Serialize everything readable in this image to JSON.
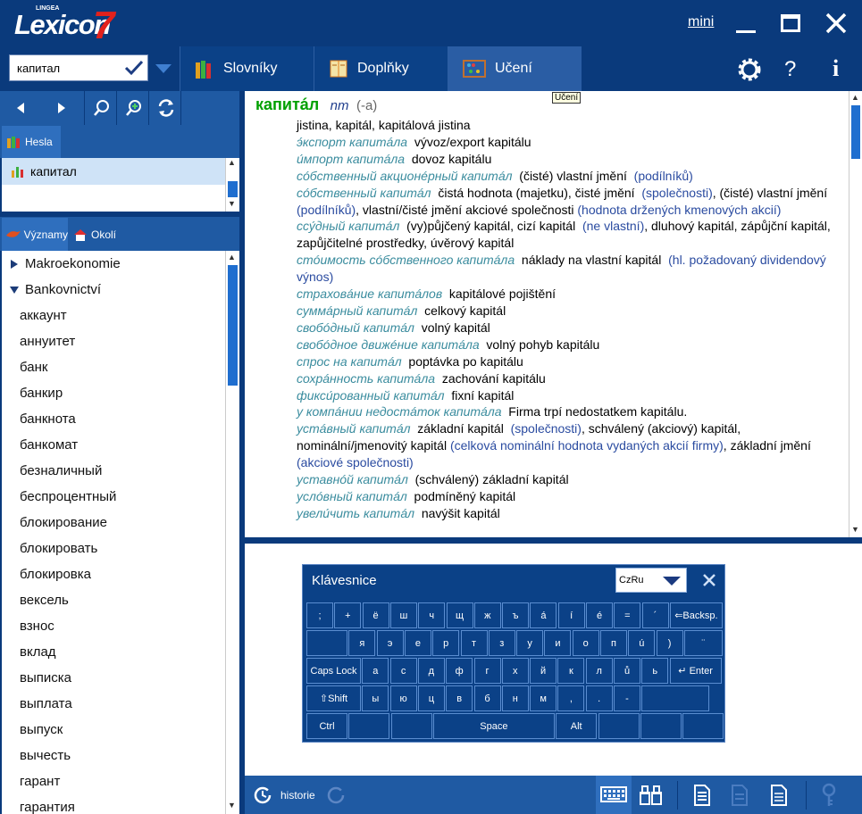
{
  "app": {
    "logo_small": "LINGEA",
    "logo_text": "Lexicon",
    "logo_version": "7",
    "mini_label": "mini"
  },
  "search": {
    "value": "капитал"
  },
  "tabs": [
    {
      "label": "Slovníky"
    },
    {
      "label": "Doplňky"
    },
    {
      "label": "Učení"
    }
  ],
  "tooltip": "Učení",
  "left": {
    "hesla_label": "Hesla",
    "hesla_items": [
      "капитал"
    ],
    "vyznamy_label": "Významy",
    "okoli_label": "Okolí",
    "tree_groups": [
      "Makroekonomie",
      "Bankovnictví"
    ],
    "tree_items": [
      "аккаунт",
      "аннуитет",
      "банк",
      "банкир",
      "банкнота",
      "банкомат",
      "безналичный",
      "беспроцентный",
      "блокирование",
      "блокировать",
      "блокировка",
      "вексель",
      "взнос",
      "вклад",
      "выписка",
      "выплата",
      "выпуск",
      "вычесть",
      "гарант",
      "гарантия"
    ]
  },
  "entry": {
    "headword": "капитáл",
    "pos": "nm",
    "gen": "(-a)",
    "first": "jistina, kapitál, kapitálová jistina",
    "lines": [
      {
        "ru": "э́кспорт капитáла",
        "cz": "vývoz/export kapitálu"
      },
      {
        "ru": "и́мпорт капитáла",
        "cz": "dovoz kapitálu"
      },
      {
        "ru": "сóбственный акционéрный капитáл",
        "cz": "(čisté) vlastní jmění",
        "cm": "(podílníků)"
      },
      {
        "ru": "сóбственный капитáл",
        "cz": "čistá hodnota (majetku), čisté jmění",
        "cm": "(společnosti)",
        "cz2": ", (čisté) vlastní jmění",
        "cm2": "(podílníků)",
        "cz3": ", vlastní/čisté jmění akciové společnosti",
        "cm3": "(hodnota držených kmenových akcií)"
      },
      {
        "ru": "ссу́дный капитáл",
        "cz": "(vy)půjčený kapitál, cizí kapitál",
        "cm": "(ne vlastní)",
        "cz2": ", dluhový kapitál, zápůjční kapitál, zapůjčitelné prostředky, úvěrový kapitál"
      },
      {
        "ru": "стóимость сóбственного капитáла",
        "cz": "náklady na vlastní kapitál",
        "cm": "(hl. požadovaný dividendový výnos)"
      },
      {
        "ru": "страховáние капитáлов",
        "cz": "kapitálové pojištění"
      },
      {
        "ru": "суммáрный капитáл",
        "cz": "celkový kapitál"
      },
      {
        "ru": "свобóдный капитáл",
        "cz": "volný kapitál"
      },
      {
        "ru": "свобóдное движéние капитáла",
        "cz": "volný pohyb kapitálu"
      },
      {
        "ru": "спрос на капитáл",
        "cz": "poptávka po kapitálu"
      },
      {
        "ru": "сохрáнность капитáла",
        "cz": "zachování kapitálu"
      },
      {
        "ru": "фикси́рованный капитáл",
        "cz": "fixní kapitál"
      },
      {
        "ru": "у компáнии недостáток капитáла",
        "cz": "Firma trpí nedostatkem kapitálu."
      },
      {
        "ru": "устáвный капитáл",
        "cz": "základní kapitál",
        "cm": "(společnosti)",
        "cz2": ", schválený (akciový) kapitál, nominální/jmenovitý kapitál",
        "cm2": "(celková nominální hodnota vydaných akcií firmy)",
        "cz3": ", základní jmění",
        "cm3": "(akciové společnosti)"
      },
      {
        "ru": "уставнóй капитáл",
        "cz": "(schválený) základní kapitál"
      },
      {
        "ru": "услóвный капитáл",
        "cz": "podmíněný kapitál"
      },
      {
        "ru": "увели́чить капитáл",
        "cz": "navýšit kapitál"
      }
    ]
  },
  "keyboard": {
    "title": "Klávesnice",
    "layout": "CzRu",
    "row1": [
      ";",
      "+",
      "ё",
      "ш",
      "ч",
      "щ",
      "ж",
      "ъ",
      "á",
      "í",
      "é",
      "=",
      "´",
      "⇐Backsp."
    ],
    "row2": [
      "",
      "я",
      "э",
      "е",
      "р",
      "т",
      "з",
      "у",
      "и",
      "о",
      "п",
      "ú",
      ")",
      "¨"
    ],
    "row3": [
      "Caps Lock",
      "а",
      "с",
      "д",
      "ф",
      "г",
      "х",
      "й",
      "к",
      "л",
      "ů",
      "ь",
      "↵ Enter"
    ],
    "row4": [
      "⇧Shift",
      "ы",
      "ю",
      "ц",
      "в",
      "б",
      "н",
      "м",
      ",",
      ".",
      "-",
      ""
    ],
    "row5": [
      "Ctrl",
      "",
      "",
      "Space",
      "Alt",
      "",
      "",
      ""
    ]
  },
  "bottom": {
    "history_label": "historie"
  },
  "colors": {
    "dark_blue": "#0a3a7c",
    "mid_blue": "#1f5aa3",
    "headword_green": "#00a000",
    "russian_teal": "#3a8c9e",
    "comment_blue": "#2a4ba0"
  }
}
